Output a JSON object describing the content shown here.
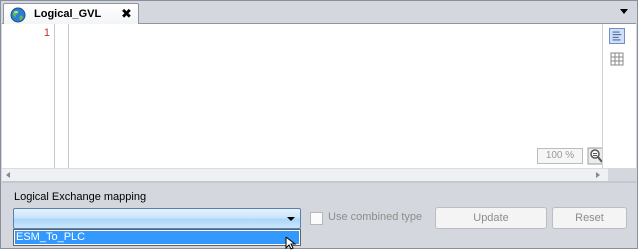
{
  "tab": {
    "title": "Logical_GVL",
    "close_label": "✖",
    "icon": "globe-icon"
  },
  "editor": {
    "line_numbers": [
      "1"
    ],
    "zoom": "100 %",
    "side_icons": [
      "declaration-text-view-icon",
      "declaration-table-view-icon"
    ]
  },
  "mapping": {
    "label": "Logical Exchange mapping",
    "selected_value": "",
    "options": [
      "ESM_To_PLC"
    ],
    "use_combined_type_label": "Use combined type",
    "update_label": "Update",
    "reset_label": "Reset"
  },
  "colors": {
    "accent": "#3399ff",
    "line_number": "#c03030",
    "disabled_text": "#8c8c8c"
  }
}
